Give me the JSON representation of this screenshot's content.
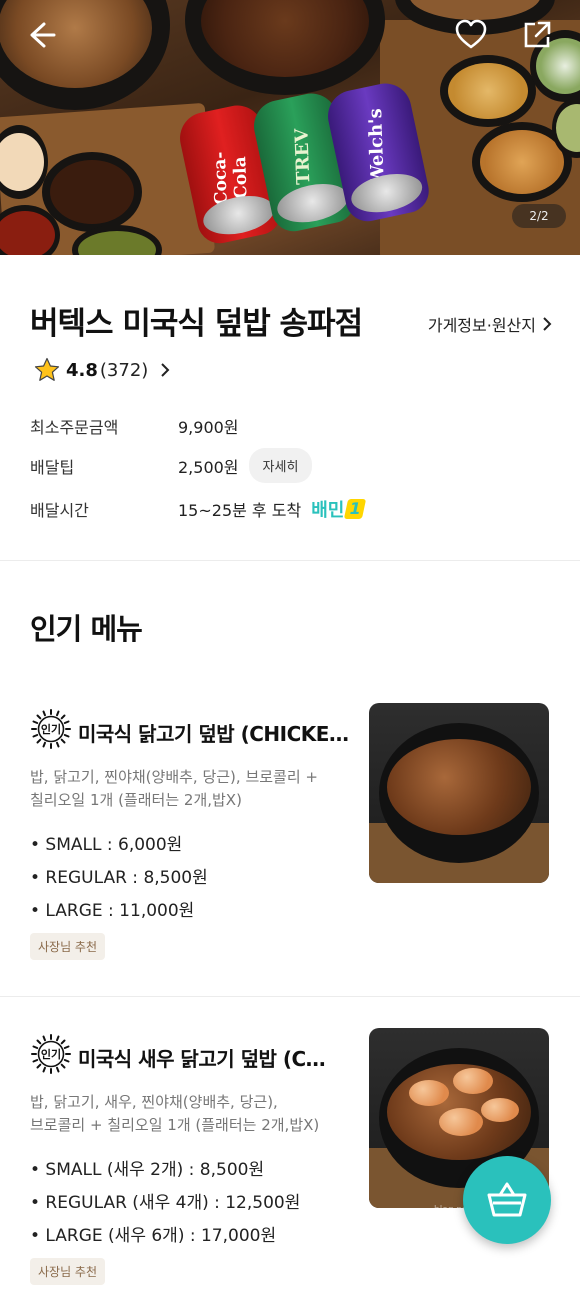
{
  "hero": {
    "page_indicator": "2/2",
    "cans": [
      "Coca-Cola",
      "TREV",
      "Welch's"
    ]
  },
  "store": {
    "name": "버텍스 미국식 덮밥 송파점",
    "info_link": "가게정보·원산지",
    "rating": "4.8",
    "review_count": "(372)",
    "min_order_label": "최소주문금액",
    "min_order_value": "9,900원",
    "delivery_tip_label": "배달팁",
    "delivery_tip_value": "2,500원",
    "detail_button": "자세히",
    "delivery_time_label": "배달시간",
    "delivery_time_value": "15~25분 후 도착",
    "baemin_badge": "배민",
    "baemin_one": "1"
  },
  "popular_menu": {
    "title": "인기 메뉴",
    "badge_text": "인기",
    "items": [
      {
        "name": "미국식 닭고기 덮밥 (CHICKEN…",
        "desc_line1": "밥, 닭고기, 찐야채(양배추, 당근), 브로콜리 +",
        "desc_line2": "칠리오일 1개 (플래터는 2개,밥X)",
        "prices": [
          "• SMALL : 6,000원",
          "• REGULAR : 8,500원",
          "• LARGE : 11,000원"
        ],
        "tag": "사장님 추천"
      },
      {
        "name": "미국식 새우 닭고기 덮밥 (C…",
        "desc_line1": "밥, 닭고기, 새우, 찐야채(양배추, 당근),",
        "desc_line2": "브로콜리 + 칠리오일 1개 (플래터는 2개,밥X)",
        "prices": [
          "• SMALL (새우 2개) : 8,500원",
          "• REGULAR (새우 4개) : 12,500원",
          "• LARGE (새우 6개) : 17,000원"
        ],
        "tag": "사장님 추천"
      }
    ]
  },
  "watermark": "blog.naver.com/yeonnao0",
  "colors": {
    "accent": "#2ac1bc",
    "tag_bg": "#f3efe9",
    "tag_text": "#8a6a4a"
  }
}
